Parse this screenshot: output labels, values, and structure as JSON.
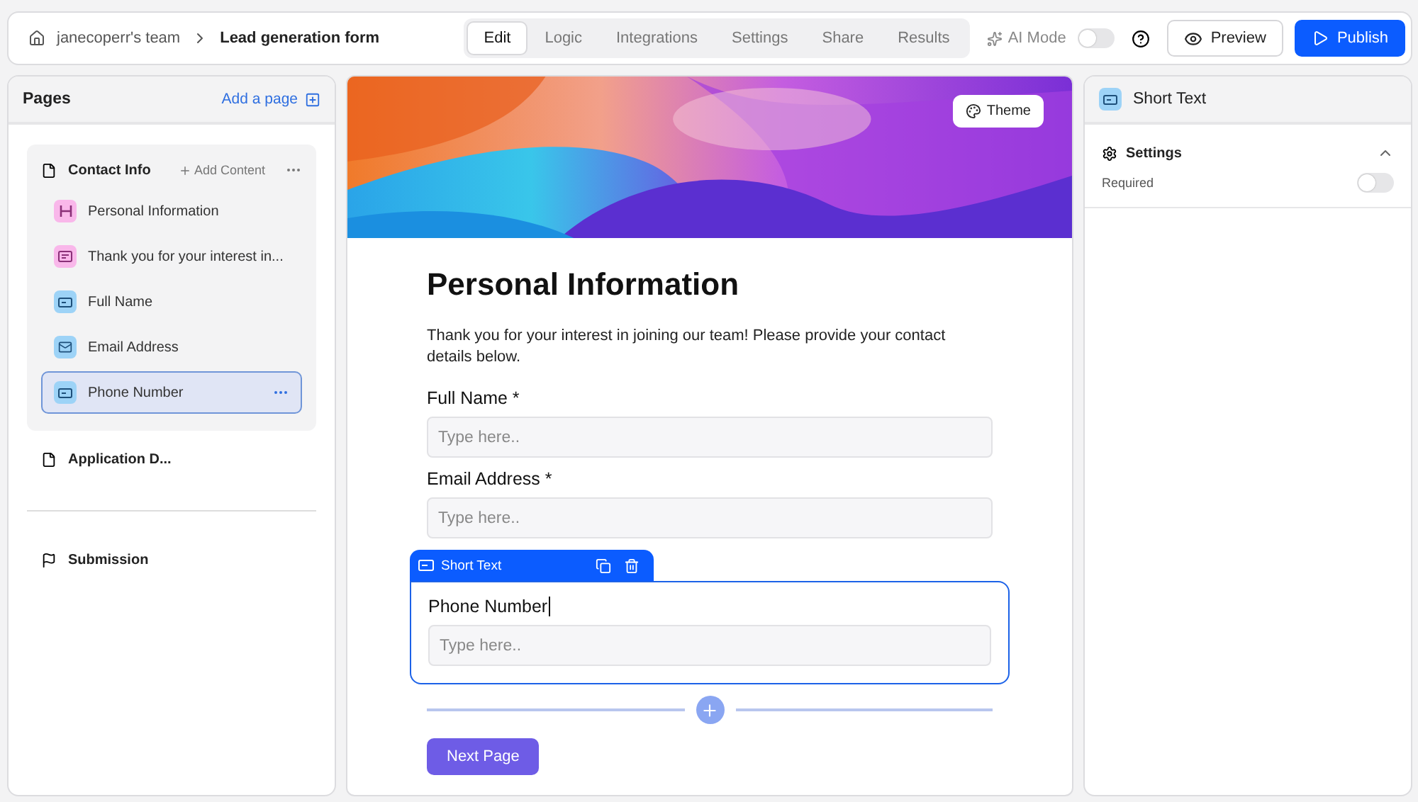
{
  "breadcrumb": {
    "team": "janecoperr's team",
    "form": "Lead generation form"
  },
  "tabs": [
    {
      "label": "Edit",
      "selected": true
    },
    {
      "label": "Logic",
      "selected": false
    },
    {
      "label": "Integrations",
      "selected": false
    },
    {
      "label": "Settings",
      "selected": false
    },
    {
      "label": "Share",
      "selected": false
    },
    {
      "label": "Results",
      "selected": false
    }
  ],
  "ai_mode": {
    "label": "AI Mode",
    "on": false
  },
  "buttons": {
    "preview": "Preview",
    "publish": "Publish"
  },
  "sidebar": {
    "title": "Pages",
    "add_page": "Add a page",
    "pages": [
      {
        "title": "Contact Info",
        "kind": "page",
        "expanded": true,
        "add_content": "Add Content",
        "children": [
          {
            "label": "Personal Information",
            "kind": "heading",
            "selected": false
          },
          {
            "label": "Thank you for your interest in...",
            "kind": "paragraph",
            "selected": false
          },
          {
            "label": "Full Name",
            "kind": "short_text",
            "selected": false
          },
          {
            "label": "Email Address",
            "kind": "email",
            "selected": false
          },
          {
            "label": "Phone Number",
            "kind": "short_text",
            "selected": true
          }
        ]
      },
      {
        "title": "Application D...",
        "kind": "page",
        "expanded": false
      },
      {
        "title": "Submission",
        "kind": "ending",
        "expanded": false
      }
    ]
  },
  "canvas": {
    "theme_button": "Theme",
    "heading": "Personal Information",
    "description": "Thank you for your interest in joining our team! Please provide your contact details below.",
    "fields": [
      {
        "label": "Full Name *",
        "placeholder": "Type here..",
        "selected": false
      },
      {
        "label": "Email Address *",
        "placeholder": "Type here..",
        "selected": false
      },
      {
        "label": "Phone Number",
        "placeholder": "Type here..",
        "selected": true,
        "toolbar": "Short Text"
      }
    ],
    "next_button": "Next Page"
  },
  "properties": {
    "title": "Short Text",
    "section": "Settings",
    "expanded": true,
    "required": {
      "label": "Required",
      "on": false
    }
  }
}
